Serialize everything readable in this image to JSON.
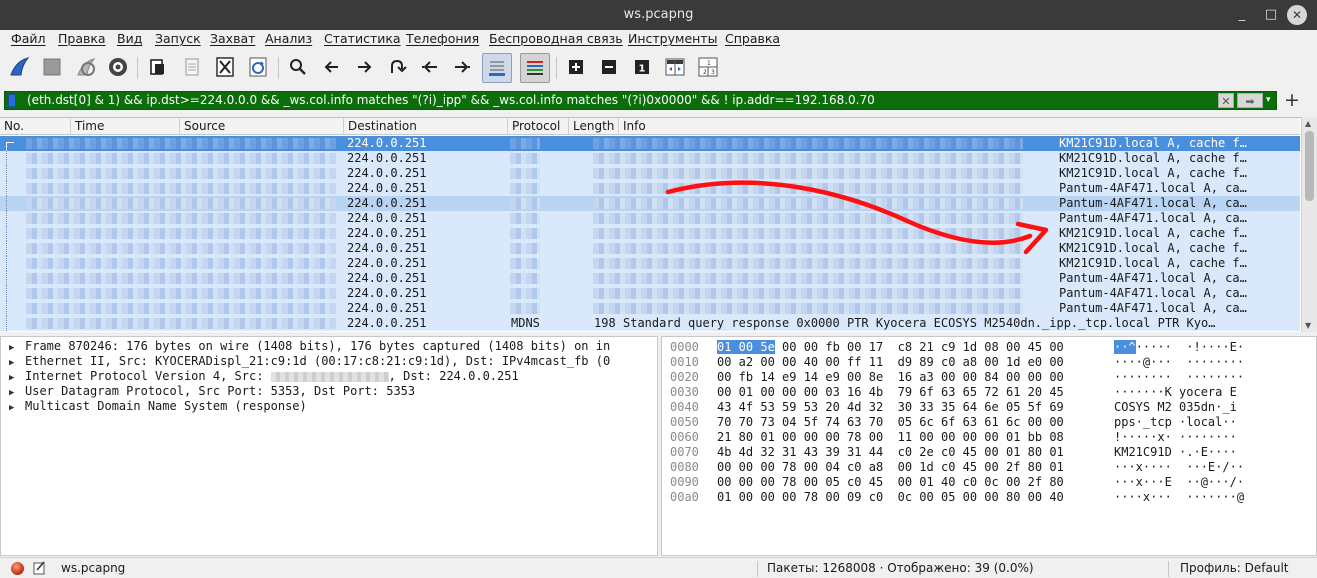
{
  "window": {
    "title": "ws.pcapng",
    "controls": [
      "_",
      "□",
      "✕"
    ]
  },
  "menu": [
    "Файл",
    "Правка",
    "Вид",
    "Запуск",
    "Захват",
    "Анализ",
    "Статистика",
    "Телефония",
    "Беспроводная связь",
    "Инструменты",
    "Справка"
  ],
  "toolbar_icons": [
    "shark-fin-start-icon",
    "stop-capture-icon",
    "restart-capture-icon",
    "capture-options-icon",
    "open-file-icon",
    "save-file-icon",
    "close-file-icon",
    "reload-file-icon",
    "find-packet-icon",
    "go-back-icon",
    "go-forward-icon",
    "go-to-packet-icon",
    "go-first-packet-icon",
    "go-last-packet-icon",
    "auto-scroll-icon",
    "colorize-icon",
    "zoom-in-icon",
    "zoom-out-icon",
    "normal-size-icon",
    "resize-columns-icon",
    "layout-icon"
  ],
  "filter": {
    "expression": "(eth.dst[0] & 1) && ip.dst>=224.0.0.0 && _ws.col.info matches \"(?i)_ipp\" && _ws.col.info matches \"(?i)0x0000\" && ! ip.addr==192.168.0.70",
    "clear_label": "✕",
    "apply_label": "➡",
    "add_label": "+"
  },
  "packet_list": {
    "columns": [
      "No.",
      "Time",
      "Source",
      "Destination",
      "Protocol",
      "Length",
      "Info"
    ],
    "rows": [
      {
        "destination": "224.0.0.251",
        "protocol": "",
        "length": "",
        "info": "KM21C91D.local A, cache f…",
        "state": "selected"
      },
      {
        "destination": "224.0.0.251",
        "protocol": "",
        "length": "",
        "info": "KM21C91D.local A, cache f…",
        "state": ""
      },
      {
        "destination": "224.0.0.251",
        "protocol": "",
        "length": "",
        "info": "KM21C91D.local A, cache f…",
        "state": ""
      },
      {
        "destination": "224.0.0.251",
        "protocol": "",
        "length": "",
        "info": "Pantum-4AF471.local A, ca…",
        "state": ""
      },
      {
        "destination": "224.0.0.251",
        "protocol": "",
        "length": "",
        "info": "Pantum-4AF471.local A, ca…",
        "state": "hover"
      },
      {
        "destination": "224.0.0.251",
        "protocol": "",
        "length": "",
        "info": "Pantum-4AF471.local A, ca…",
        "state": ""
      },
      {
        "destination": "224.0.0.251",
        "protocol": "",
        "length": "",
        "info": "KM21C91D.local A, cache f…",
        "state": ""
      },
      {
        "destination": "224.0.0.251",
        "protocol": "",
        "length": "",
        "info": "KM21C91D.local A, cache f…",
        "state": ""
      },
      {
        "destination": "224.0.0.251",
        "protocol": "",
        "length": "",
        "info": "KM21C91D.local A, cache f…",
        "state": ""
      },
      {
        "destination": "224.0.0.251",
        "protocol": "",
        "length": "",
        "info": "Pantum-4AF471.local A, ca…",
        "state": ""
      },
      {
        "destination": "224.0.0.251",
        "protocol": "",
        "length": "",
        "info": "Pantum-4AF471.local A, ca…",
        "state": ""
      },
      {
        "destination": "224.0.0.251",
        "protocol": "",
        "length": "",
        "info": "Pantum-4AF471.local A, ca…",
        "state": ""
      },
      {
        "destination": "224.0.0.251",
        "protocol": "MDNS",
        "length": "198",
        "info": "Standard query response 0x0000 PTR Kyocera ECOSYS M2540dn._ipp._tcp.local PTR Kyo…",
        "state": ""
      }
    ]
  },
  "details": [
    "Frame 870246: 176 bytes on wire (1408 bits), 176 bytes captured (1408 bits) on in",
    "Ethernet II, Src: KYOCERADispl_21:c9:1d (00:17:c8:21:c9:1d), Dst: IPv4mcast_fb (0",
    "Internet Protocol Version 4, Src:",
    ", Dst: 224.0.0.251",
    "User Datagram Protocol, Src Port: 5353, Dst Port: 5353",
    "Multicast Domain Name System (response)"
  ],
  "bytes": [
    {
      "off": "0000",
      "hex_hl": "01 00 5e",
      "hex": " 00 00 fb 00 17  c8 21 c9 1d 08 00 45 00",
      "asc_hl": "··^",
      "asc": "·····  ·!····E·"
    },
    {
      "off": "0010",
      "hex_hl": "",
      "hex": "00 a2 00 00 40 00 ff 11  d9 89 c0 a8 00 1d e0 00",
      "asc_hl": "",
      "asc": "····@···  ········"
    },
    {
      "off": "0020",
      "hex_hl": "",
      "hex": "00 fb 14 e9 14 e9 00 8e  16 a3 00 00 84 00 00 00",
      "asc_hl": "",
      "asc": "········  ········"
    },
    {
      "off": "0030",
      "hex_hl": "",
      "hex": "00 01 00 00 00 03 16 4b  79 6f 63 65 72 61 20 45",
      "asc_hl": "",
      "asc": "·······K yocera E"
    },
    {
      "off": "0040",
      "hex_hl": "",
      "hex": "43 4f 53 59 53 20 4d 32  30 33 35 64 6e 05 5f 69",
      "asc_hl": "",
      "asc": "COSYS M2 035dn·_i"
    },
    {
      "off": "0050",
      "hex_hl": "",
      "hex": "70 70 73 04 5f 74 63 70  05 6c 6f 63 61 6c 00 00",
      "asc_hl": "",
      "asc": "pps·_tcp ·local··"
    },
    {
      "off": "0060",
      "hex_hl": "",
      "hex": "21 80 01 00 00 00 78 00  11 00 00 00 00 01 bb 08",
      "asc_hl": "",
      "asc": "!·····x· ········"
    },
    {
      "off": "0070",
      "hex_hl": "",
      "hex": "4b 4d 32 31 43 39 31 44  c0 2e c0 45 00 01 80 01",
      "asc_hl": "",
      "asc": "KM21C91D ·.·E····"
    },
    {
      "off": "0080",
      "hex_hl": "",
      "hex": "00 00 00 78 00 04 c0 a8  00 1d c0 45 00 2f 80 01",
      "asc_hl": "",
      "asc": "···x····  ···E·/··"
    },
    {
      "off": "0090",
      "hex_hl": "",
      "hex": "00 00 00 78 00 05 c0 45  00 01 40 c0 0c 00 2f 80",
      "asc_hl": "",
      "asc": "···x···E  ··@···/·"
    },
    {
      "off": "00a0",
      "hex_hl": "",
      "hex": "01 00 00 00 78 00 09 c0  0c 00 05 00 00 80 00 40",
      "asc_hl": "",
      "asc": "····x···  ·······@"
    }
  ],
  "status": {
    "file": "ws.pcapng",
    "packets": "Пакеты: 1268008 · Отображено: 39 (0.0%)",
    "profile": "Профиль: Default"
  },
  "colors": {
    "filter_valid_bg": "#0b6e0b",
    "row_bg": "#dae8fc",
    "row_selected": "#4a8fde",
    "annotation_arrow": "#ff0000"
  }
}
